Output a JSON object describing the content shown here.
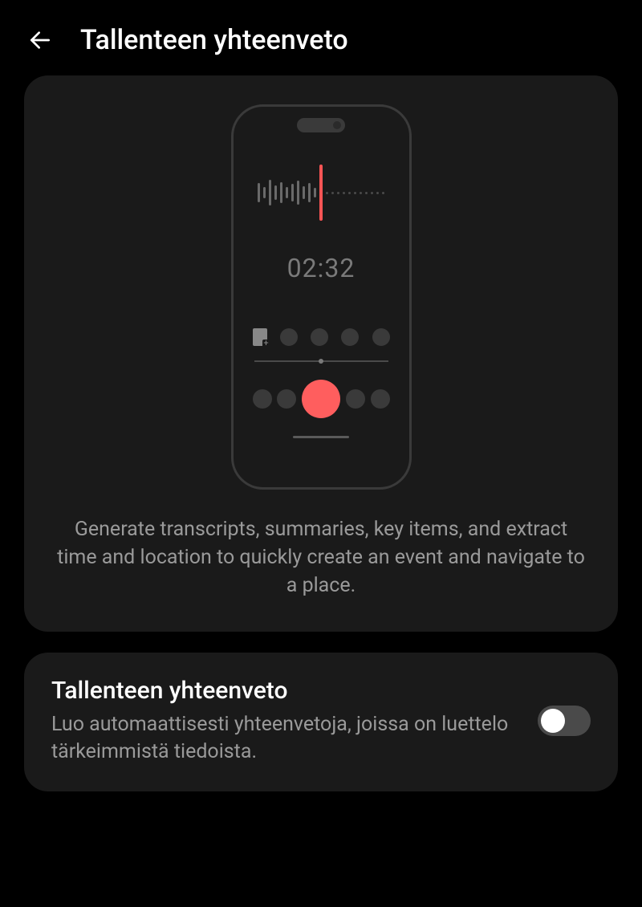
{
  "header": {
    "title": "Tallenteen yhteenveto"
  },
  "illustration": {
    "timer": "02:32"
  },
  "feature": {
    "description": "Generate transcripts, summaries, key items, and extract time and location to quickly create an event and navigate to a place."
  },
  "setting": {
    "title": "Tallenteen yhteenveto",
    "subtitle": "Luo automaattisesti yhteenvetoja, joissa on luettelo tärkeimmistä tiedoista.",
    "enabled": false
  },
  "colors": {
    "background": "#000000",
    "card": "#1a1a1a",
    "accent": "#ff5e5e",
    "text_primary": "#ffffff",
    "text_secondary": "#9a9a9a"
  }
}
